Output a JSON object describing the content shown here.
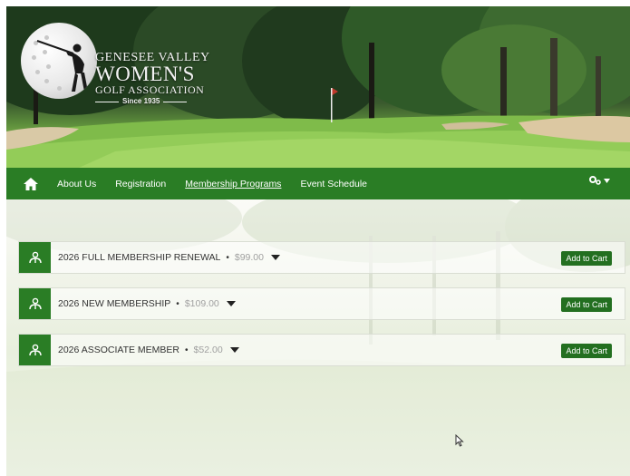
{
  "logo": {
    "line1": "GENESEE VALLEY",
    "line2": "WOMEN'S",
    "line3": "GOLF ASSOCIATION",
    "line4": "Since 1935"
  },
  "nav": {
    "home_icon": "home-icon",
    "items": [
      {
        "label": "About Us"
      },
      {
        "label": "Registration"
      },
      {
        "label": "Membership Programs",
        "active": true
      },
      {
        "label": "Event Schedule"
      }
    ],
    "settings_icon": "gears-icon"
  },
  "memberships": [
    {
      "title": "2026 FULL MEMBERSHIP RENEWAL",
      "separator": "•",
      "price": "$99.00",
      "button": "Add to Cart"
    },
    {
      "title": "2026 NEW MEMBERSHIP",
      "separator": "•",
      "price": "$109.00",
      "button": "Add to Cart"
    },
    {
      "title": "2026 ASSOCIATE MEMBER",
      "separator": "•",
      "price": "$52.00",
      "button": "Add to Cart"
    }
  ],
  "colors": {
    "primary_green": "#2a7d25",
    "button_green": "#236f20",
    "price_gray": "#a0a0a0"
  }
}
